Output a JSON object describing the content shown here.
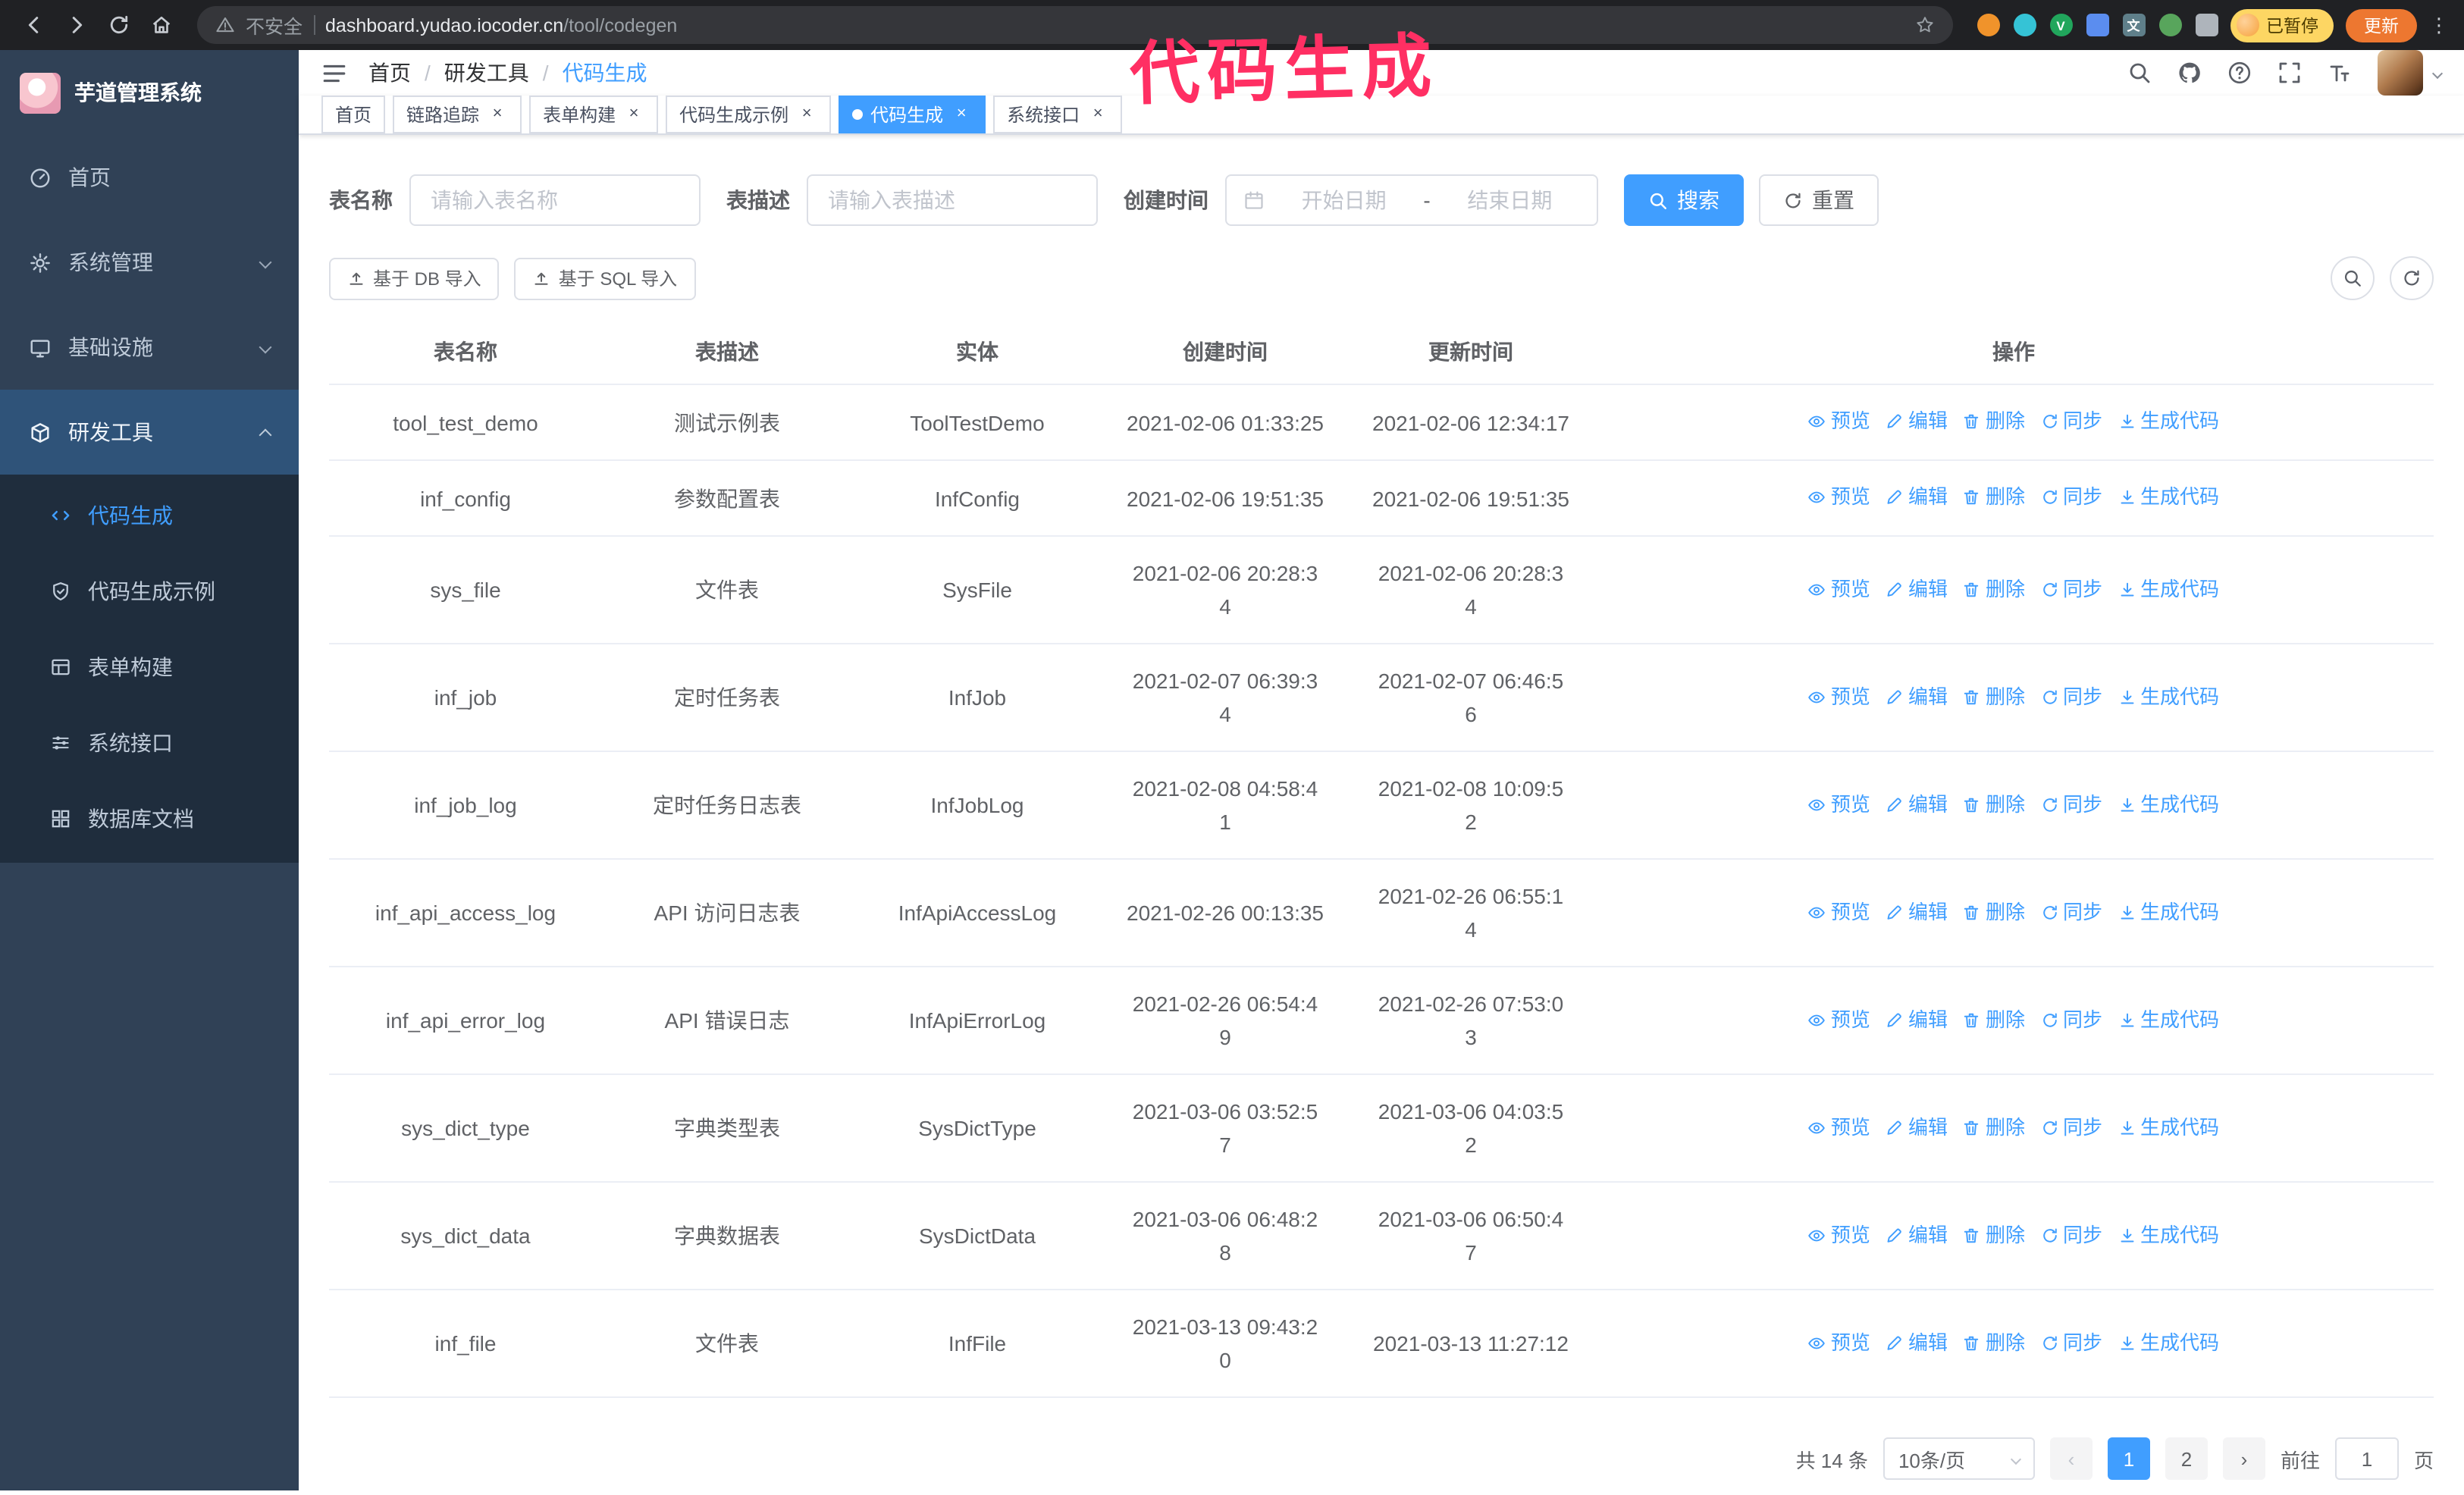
{
  "theme": {
    "accent": "#409EFF",
    "sidebar_bg": "#304156",
    "submenu_bg": "#1f2d3d",
    "annotation_color": "#ff2f63"
  },
  "icons": {
    "close": "×",
    "kebab": "⋮",
    "prev": "‹",
    "next": "›"
  },
  "browser": {
    "security_warning": "不安全",
    "url_host": "dashboard.yudao.iocoder.cn",
    "url_path": "/tool/codegen",
    "paused_badge": "已暂停",
    "update_button": "更新"
  },
  "annotation": {
    "text": "代码生成"
  },
  "sidebar": {
    "logo_title": "芋道管理系统",
    "items": [
      {
        "label": "首页"
      },
      {
        "label": "系统管理"
      },
      {
        "label": "基础设施"
      },
      {
        "label": "研发工具"
      }
    ],
    "sub_items": [
      {
        "label": "代码生成"
      },
      {
        "label": "代码生成示例"
      },
      {
        "label": "表单构建"
      },
      {
        "label": "系统接口"
      },
      {
        "label": "数据库文档"
      }
    ]
  },
  "breadcrumb": {
    "items": [
      "首页",
      "研发工具",
      "代码生成"
    ]
  },
  "tabs": [
    {
      "label": "首页"
    },
    {
      "label": "链路追踪"
    },
    {
      "label": "表单构建"
    },
    {
      "label": "代码生成示例"
    },
    {
      "label": "代码生成"
    },
    {
      "label": "系统接口"
    }
  ],
  "filters": {
    "name_label": "表名称",
    "name_placeholder": "请输入表名称",
    "desc_label": "表描述",
    "desc_placeholder": "请输入表描述",
    "time_label": "创建时间",
    "date_start": "开始日期",
    "date_sep": "-",
    "date_end": "结束日期",
    "search": "搜索",
    "reset": "重置"
  },
  "toolbar": {
    "import_db": "基于 DB 导入",
    "import_sql": "基于 SQL 导入"
  },
  "table": {
    "columns": [
      "表名称",
      "表描述",
      "实体",
      "创建时间",
      "更新时间",
      "操作"
    ],
    "actions": [
      {
        "key": "preview",
        "label": "预览"
      },
      {
        "key": "edit",
        "label": "编辑"
      },
      {
        "key": "delete",
        "label": "删除"
      },
      {
        "key": "sync",
        "label": "同步"
      },
      {
        "key": "generate",
        "label": "生成代码"
      }
    ],
    "rows": [
      {
        "name": "tool_test_demo",
        "desc": "测试示例表",
        "entity": "ToolTestDemo",
        "created": "2021-02-06 01:33:25",
        "updated": "2021-02-06 12:34:17"
      },
      {
        "name": "inf_config",
        "desc": "参数配置表",
        "entity": "InfConfig",
        "created": "2021-02-06 19:51:35",
        "updated": "2021-02-06 19:51:35"
      },
      {
        "name": "sys_file",
        "desc": "文件表",
        "entity": "SysFile",
        "created": "2021-02-06 20:28:3\n4",
        "updated": "2021-02-06 20:28:3\n4"
      },
      {
        "name": "inf_job",
        "desc": "定时任务表",
        "entity": "InfJob",
        "created": "2021-02-07 06:39:3\n4",
        "updated": "2021-02-07 06:46:5\n6"
      },
      {
        "name": "inf_job_log",
        "desc": "定时任务日志表",
        "entity": "InfJobLog",
        "created": "2021-02-08 04:58:4\n1",
        "updated": "2021-02-08 10:09:5\n2"
      },
      {
        "name": "inf_api_access_log",
        "desc": "API 访问日志表",
        "entity": "InfApiAccessLog",
        "created": "2021-02-26 00:13:35",
        "updated": "2021-02-26 06:55:1\n4"
      },
      {
        "name": "inf_api_error_log",
        "desc": "API 错误日志",
        "entity": "InfApiErrorLog",
        "created": "2021-02-26 06:54:4\n9",
        "updated": "2021-02-26 07:53:0\n3"
      },
      {
        "name": "sys_dict_type",
        "desc": "字典类型表",
        "entity": "SysDictType",
        "created": "2021-03-06 03:52:5\n7",
        "updated": "2021-03-06 04:03:5\n2"
      },
      {
        "name": "sys_dict_data",
        "desc": "字典数据表",
        "entity": "SysDictData",
        "created": "2021-03-06 06:48:2\n8",
        "updated": "2021-03-06 06:50:4\n7"
      },
      {
        "name": "inf_file",
        "desc": "文件表",
        "entity": "InfFile",
        "created": "2021-03-13 09:43:2\n0",
        "updated": "2021-03-13 11:27:12"
      }
    ]
  },
  "pagination": {
    "total": "共 14 条",
    "page_size": "10条/页",
    "pages": [
      "1",
      "2"
    ],
    "goto_label": "前往",
    "goto_value": "1",
    "goto_suffix": "页"
  }
}
